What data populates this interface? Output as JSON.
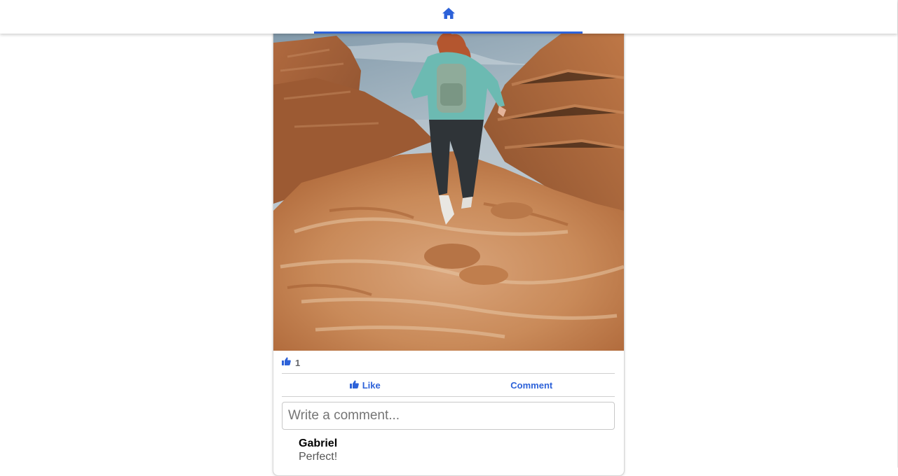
{
  "nav": {
    "home_icon": "home-icon",
    "accent_color": "#2d62d9"
  },
  "post": {
    "photo_description_icon": "photo-hiker-on-coastal-rocks",
    "likes": {
      "icon": "thumbs-up-icon",
      "count": "1"
    },
    "actions": {
      "like_label": "Like",
      "comment_label": "Comment"
    },
    "comment_box": {
      "placeholder": "Write a comment...",
      "value": ""
    },
    "comments": [
      {
        "author": "Gabriel",
        "text": "Perfect!"
      }
    ]
  }
}
